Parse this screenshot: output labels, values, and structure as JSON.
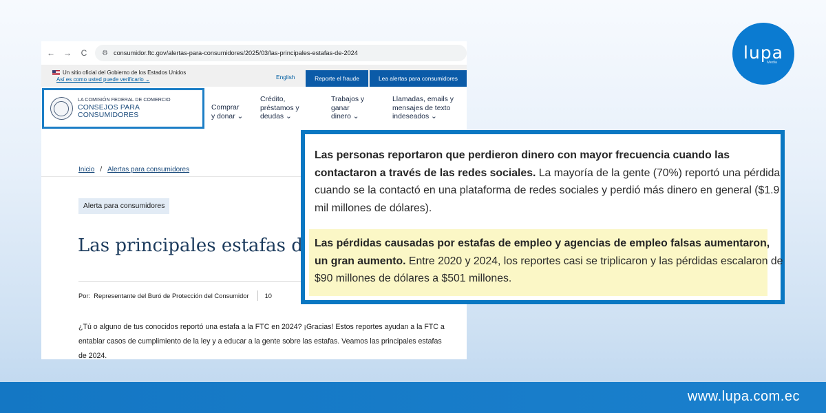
{
  "browser": {
    "back_icon": "←",
    "forward_icon": "→",
    "reload_icon": "C",
    "site_settings_icon": "⚙",
    "url": "consumidor.ftc.gov/alertas-para-consumidores/2025/03/las-principales-estafas-de-2024"
  },
  "gov_banner": {
    "official_text": "Un sitio oficial del Gobierno de los Estados Unidos",
    "verify_link": "Así es como usted puede verificarlo ⌄",
    "english_link": "English",
    "report_button": "Reporte el fraude",
    "alerts_button": "Lea alertas para consumidores"
  },
  "site_header": {
    "logo_small": "LA COMISIÓN FEDERAL DE COMERCIO",
    "logo_big": "CONSEJOS PARA CONSUMIDORES",
    "menu": [
      {
        "label": "Comprar\ny donar ⌄"
      },
      {
        "label": "Crédito,\npréstamos y\ndeudas ⌄"
      },
      {
        "label": "Trabajos y\nganar\ndinero ⌄"
      },
      {
        "label": "Llamadas, emails y\nmensajes de texto\nindeseados ⌄"
      }
    ]
  },
  "article": {
    "breadcrumb_home": "Inicio",
    "breadcrumb_sep": "/",
    "breadcrumb_section": "Alertas para consumidores",
    "tag": "Alerta para consumidores",
    "title": "Las principales estafas de",
    "by_label": "Por:",
    "author": "Representante del Buró de Protección del Consumidor",
    "date_fragment": "10",
    "intro": "¿Tú o alguno de tus conocidos reportó una estafa a la FTC en 2024? ¡Gracias! Estos reportes ayudan a la FTC a entablar casos de cumplimiento de la ley y a educar a la gente sobre las estafas. Veamos las principales estafas de 2024."
  },
  "callout": {
    "p1_bold": "Las personas reportaron que perdieron dinero con mayor frecuencia cuando las contactaron a través de las redes sociales.",
    "p1_rest": " La mayoría de la gente (70%) reportó una pérdida cuando se la contactó en una plataforma de redes sociales y perdió más dinero en general ($1.9 mil millones de dólares).",
    "p2_bold": "Las pérdidas causadas por estafas de empleo y agencias de empleo falsas aumentaron, un gran aumento.",
    "p2_rest": " Entre 2020 y 2024, los reportes casi se triplicaron y las pérdidas escalaron de $90 millones de dólares a $501 millones."
  },
  "brand": {
    "logo_word": "lupa",
    "logo_sub": "Media",
    "footer_url": "www.lupa.com.ec"
  },
  "colors": {
    "brand_blue": "#0a77c2",
    "ftc_button": "#0b5ba8",
    "highlight": "#fbf7c6"
  }
}
